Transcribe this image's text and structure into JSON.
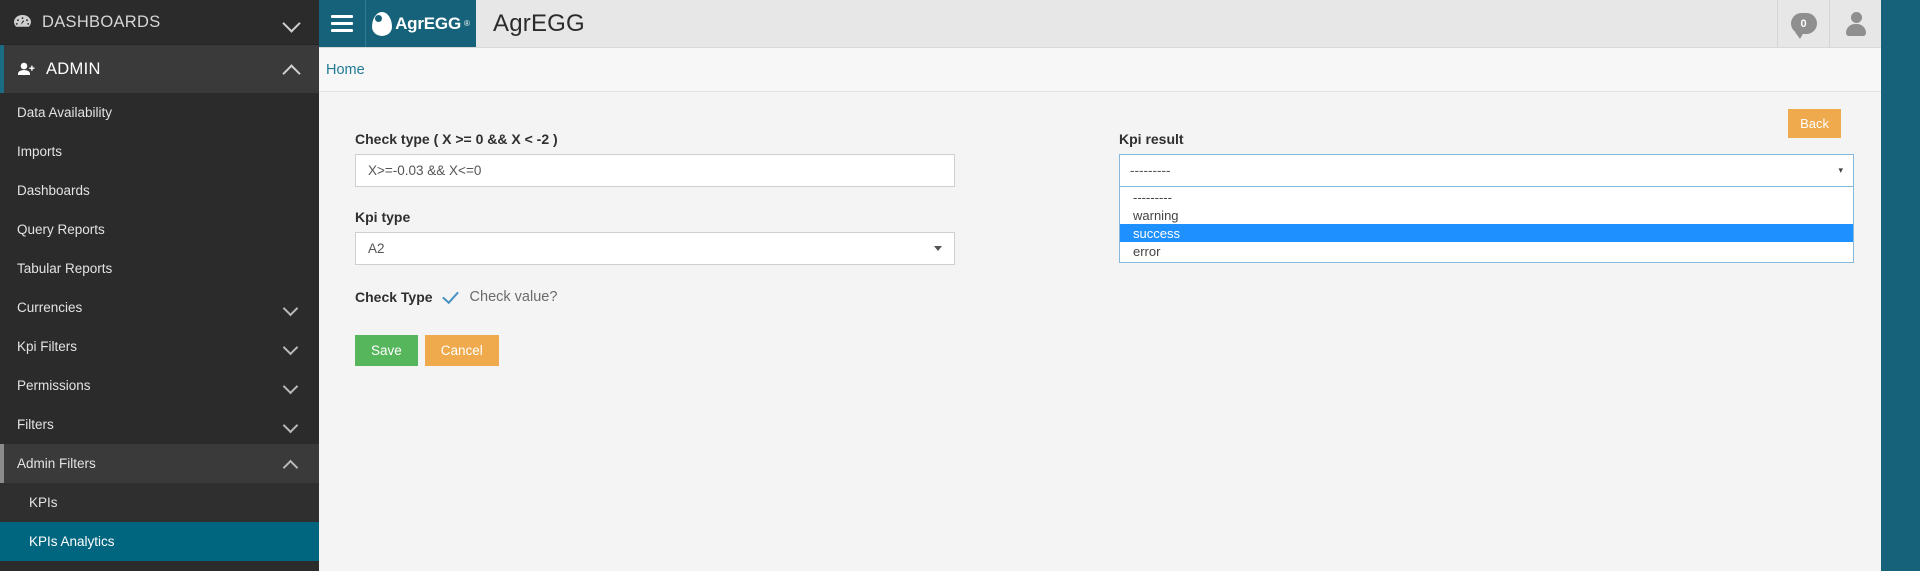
{
  "sidebar": {
    "dashboards": {
      "label": "DASHBOARDS",
      "icon": "tachometer-icon",
      "chevron": "chevron-down-icon"
    },
    "admin": {
      "label": "ADMIN",
      "icon": "user-plus-icon",
      "chevron": "chevron-up-icon"
    },
    "items": [
      {
        "label": "Data Availability",
        "expandable": false
      },
      {
        "label": "Imports",
        "expandable": false
      },
      {
        "label": "Dashboards",
        "expandable": false
      },
      {
        "label": "Query Reports",
        "expandable": false
      },
      {
        "label": "Tabular Reports",
        "expandable": false
      },
      {
        "label": "Currencies",
        "expandable": true
      },
      {
        "label": "Kpi Filters",
        "expandable": true
      },
      {
        "label": "Permissions",
        "expandable": true
      },
      {
        "label": "Filters",
        "expandable": true
      },
      {
        "label": "Admin Filters",
        "expandable": true,
        "expanded": true
      }
    ],
    "sub_items": [
      {
        "label": "KPIs",
        "active": false
      },
      {
        "label": "KPIs Analytics",
        "active": true
      }
    ],
    "colors": {
      "background": "#2b2b2b",
      "active": "#00657f",
      "section": "#3a3a3a"
    }
  },
  "navbar": {
    "burger_icon": "hamburger-menu-icon",
    "logo_text": "AgrEGG",
    "logo_registered": "®",
    "title": "AgrEGG",
    "message_count": "0",
    "message_icon": "comment-bubble-icon",
    "user_icon": "user-avatar-icon",
    "brand_color": "#15627a"
  },
  "breadcrumb": {
    "home": "Home"
  },
  "content": {
    "back_label": "Back",
    "check_type": {
      "label": "Check type ( X >= 0 && X < -2 )",
      "value": "X>=-0.03 && X<=0",
      "placeholder": "X>=0 && X<-2"
    },
    "kpi_type": {
      "label": "Kpi type",
      "value": "A2"
    },
    "check_type_toggle": {
      "label": "Check Type",
      "icon": "check-mark-icon",
      "question": "Check value?"
    },
    "kpi_result": {
      "label": "Kpi result",
      "value": "---------",
      "caret": "▾",
      "options": [
        {
          "label": "---------",
          "selected": false
        },
        {
          "label": "warning",
          "selected": false
        },
        {
          "label": "success",
          "selected": true
        },
        {
          "label": "error",
          "selected": false
        }
      ]
    },
    "buttons": {
      "save": "Save",
      "cancel": "Cancel"
    },
    "colors": {
      "save": "#56b65b",
      "cancel": "#eeaa4d",
      "back": "#eeaa4d",
      "highlight": "#1e90ff"
    }
  }
}
